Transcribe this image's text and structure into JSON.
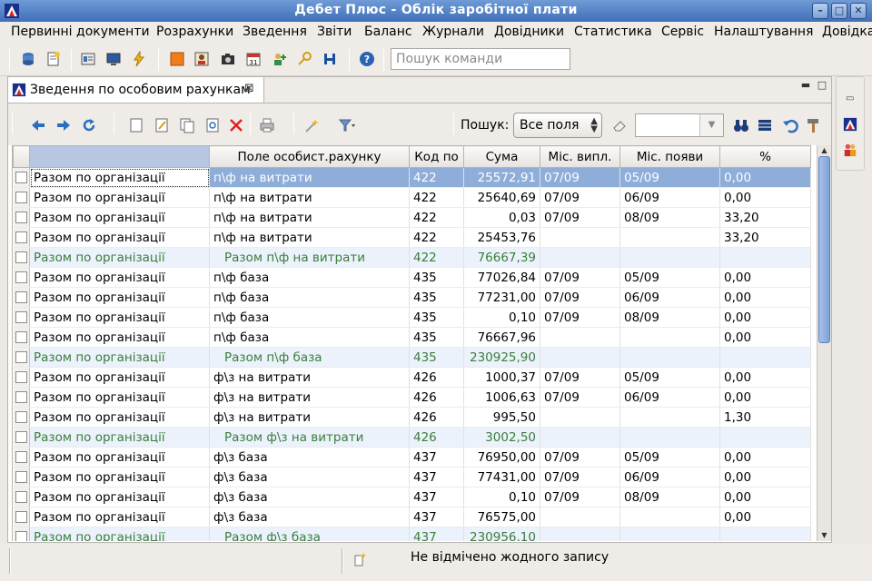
{
  "window": {
    "title": "Дебет Плюс - Облік заробітної плати",
    "buttons": {
      "minimize": "–",
      "maximize": "□",
      "close": "✕"
    }
  },
  "menu": [
    "Первинні документи",
    "Розрахунки",
    "Зведення",
    "Звіти",
    "Баланс",
    "Журнали",
    "Довідники",
    "Статистика",
    "Сервіс",
    "Налаштування",
    "Довідка"
  ],
  "toolbar": {
    "command_search_placeholder": "Пошук команди"
  },
  "view": {
    "tab_title": "Зведення по особовим рахункам",
    "tab_close": "⊠",
    "search_label": "Пошук:",
    "search_scope": "Все поля",
    "search_value": ""
  },
  "grid": {
    "columns": [
      "",
      "Поле особист.рахунку",
      "Код по",
      "Сума",
      "Міс. випл.",
      "Міс. появи",
      "%"
    ],
    "rows": [
      {
        "org": "Разом по організації",
        "field": "п\\ф на витрати",
        "code": "422",
        "sum": "25572,91",
        "pay_month": "07/09",
        "appear_month": "05/09",
        "pct": "0,00",
        "type": "selected"
      },
      {
        "org": "Разом по організації",
        "field": "п\\ф на витрати",
        "code": "422",
        "sum": "25640,69",
        "pay_month": "07/09",
        "appear_month": "06/09",
        "pct": "0,00",
        "type": "normal"
      },
      {
        "org": "Разом по організації",
        "field": "п\\ф на витрати",
        "code": "422",
        "sum": "0,03",
        "pay_month": "07/09",
        "appear_month": "08/09",
        "pct": "33,20",
        "type": "normal"
      },
      {
        "org": "Разом по організації",
        "field": "п\\ф на витрати",
        "code": "422",
        "sum": "25453,76",
        "pay_month": "",
        "appear_month": "",
        "pct": "33,20",
        "type": "normal"
      },
      {
        "org": "Разом по організації",
        "field": "Разом п\\ф на витрати",
        "code": "422",
        "sum": "76667,39",
        "pay_month": "",
        "appear_month": "",
        "pct": "",
        "type": "subtotal"
      },
      {
        "org": "Разом по організації",
        "field": "п\\ф база",
        "code": "435",
        "sum": "77026,84",
        "pay_month": "07/09",
        "appear_month": "05/09",
        "pct": "0,00",
        "type": "normal"
      },
      {
        "org": "Разом по організації",
        "field": "п\\ф база",
        "code": "435",
        "sum": "77231,00",
        "pay_month": "07/09",
        "appear_month": "06/09",
        "pct": "0,00",
        "type": "normal"
      },
      {
        "org": "Разом по організації",
        "field": "п\\ф база",
        "code": "435",
        "sum": "0,10",
        "pay_month": "07/09",
        "appear_month": "08/09",
        "pct": "0,00",
        "type": "normal"
      },
      {
        "org": "Разом по організації",
        "field": "п\\ф база",
        "code": "435",
        "sum": "76667,96",
        "pay_month": "",
        "appear_month": "",
        "pct": "0,00",
        "type": "normal"
      },
      {
        "org": "Разом по організації",
        "field": "Разом п\\ф база",
        "code": "435",
        "sum": "230925,90",
        "pay_month": "",
        "appear_month": "",
        "pct": "",
        "type": "subtotal"
      },
      {
        "org": "Разом по організації",
        "field": "ф\\з на витрати",
        "code": "426",
        "sum": "1000,37",
        "pay_month": "07/09",
        "appear_month": "05/09",
        "pct": "0,00",
        "type": "normal"
      },
      {
        "org": "Разом по організації",
        "field": "ф\\з на витрати",
        "code": "426",
        "sum": "1006,63",
        "pay_month": "07/09",
        "appear_month": "06/09",
        "pct": "0,00",
        "type": "normal"
      },
      {
        "org": "Разом по організації",
        "field": "ф\\з на витрати",
        "code": "426",
        "sum": "995,50",
        "pay_month": "",
        "appear_month": "",
        "pct": "1,30",
        "type": "normal"
      },
      {
        "org": "Разом по організації",
        "field": "Разом ф\\з на витрати",
        "code": "426",
        "sum": "3002,50",
        "pay_month": "",
        "appear_month": "",
        "pct": "",
        "type": "subtotal"
      },
      {
        "org": "Разом по організації",
        "field": "ф\\з база",
        "code": "437",
        "sum": "76950,00",
        "pay_month": "07/09",
        "appear_month": "05/09",
        "pct": "0,00",
        "type": "normal"
      },
      {
        "org": "Разом по організації",
        "field": "ф\\з база",
        "code": "437",
        "sum": "77431,00",
        "pay_month": "07/09",
        "appear_month": "06/09",
        "pct": "0,00",
        "type": "normal"
      },
      {
        "org": "Разом по організації",
        "field": "ф\\з база",
        "code": "437",
        "sum": "0,10",
        "pay_month": "07/09",
        "appear_month": "08/09",
        "pct": "0,00",
        "type": "normal"
      },
      {
        "org": "Разом по організації",
        "field": "ф\\з база",
        "code": "437",
        "sum": "76575,00",
        "pay_month": "",
        "appear_month": "",
        "pct": "0,00",
        "type": "normal"
      },
      {
        "org": "Разом по організації",
        "field": "Разом ф\\з база",
        "code": "437",
        "sum": "230956,10",
        "pay_month": "",
        "appear_month": "",
        "pct": "",
        "type": "subtotal"
      }
    ]
  },
  "status": {
    "text": "Не відмічено жодного запису"
  },
  "icons": {
    "app": "debet-plus-logo-icon",
    "toolbar": [
      "database-icon",
      "new-document-icon",
      "journal-icon",
      "monitor-icon",
      "lightning-icon",
      "orange-box-icon",
      "person-card-icon",
      "camera-icon",
      "calendar-icon",
      "user-add-icon",
      "key-icon",
      "tools-icon",
      "help-icon"
    ]
  },
  "colors": {
    "title_gradient_top": "#6f9bd6",
    "selection": "#8eadd9",
    "subtotal_text": "#3b7d3b",
    "subtotal_bg": "#ebf2fb"
  }
}
